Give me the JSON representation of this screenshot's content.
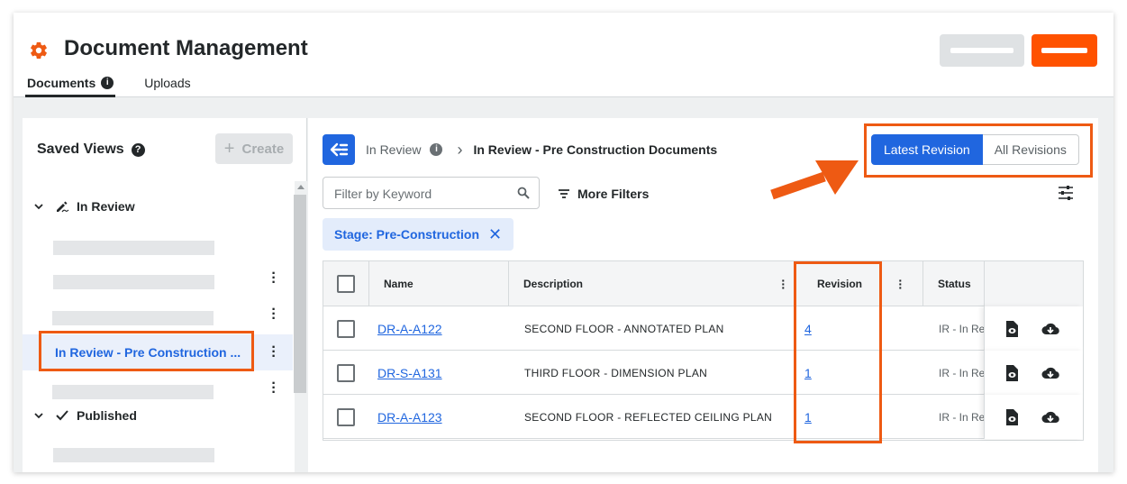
{
  "header": {
    "title": "Document Management",
    "tabs": [
      {
        "label": "Documents",
        "active": true
      },
      {
        "label": "Uploads",
        "active": false
      }
    ]
  },
  "saved_views": {
    "title": "Saved Views",
    "help": "?",
    "create_label": "Create",
    "groups": [
      {
        "label": "In Review",
        "icon": "pencil-sign-icon"
      },
      {
        "label": "Published",
        "icon": "checkmark-icon"
      }
    ],
    "selected_item": "In Review - Pre Construction ..."
  },
  "breadcrumb": {
    "parent": "In Review",
    "current": "In Review - Pre Construction Documents"
  },
  "revision_toggle": {
    "latest": "Latest Revision",
    "all": "All Revisions"
  },
  "filters": {
    "keyword_placeholder": "Filter by Keyword",
    "more_filters": "More Filters",
    "chip": "Stage: Pre-Construction"
  },
  "table": {
    "columns": [
      "Name",
      "Description",
      "Revision",
      "Status"
    ],
    "rows": [
      {
        "name": "DR-A-A122",
        "description": "SECOND FLOOR - ANNOTATED PLAN",
        "revision": "4",
        "status": "IR - In Re"
      },
      {
        "name": "DR-S-A131",
        "description": "THIRD FLOOR - DIMENSION PLAN",
        "revision": "1",
        "status": "IR - In Re"
      },
      {
        "name": "DR-A-A123",
        "description": "SECOND FLOOR - REFLECTED CEILING PLAN",
        "revision": "1",
        "status": "IR - In Re"
      }
    ]
  },
  "colors": {
    "brand_orange": "#ff5200",
    "highlight_orange": "#ee5a13",
    "primary_blue": "#2066df"
  }
}
